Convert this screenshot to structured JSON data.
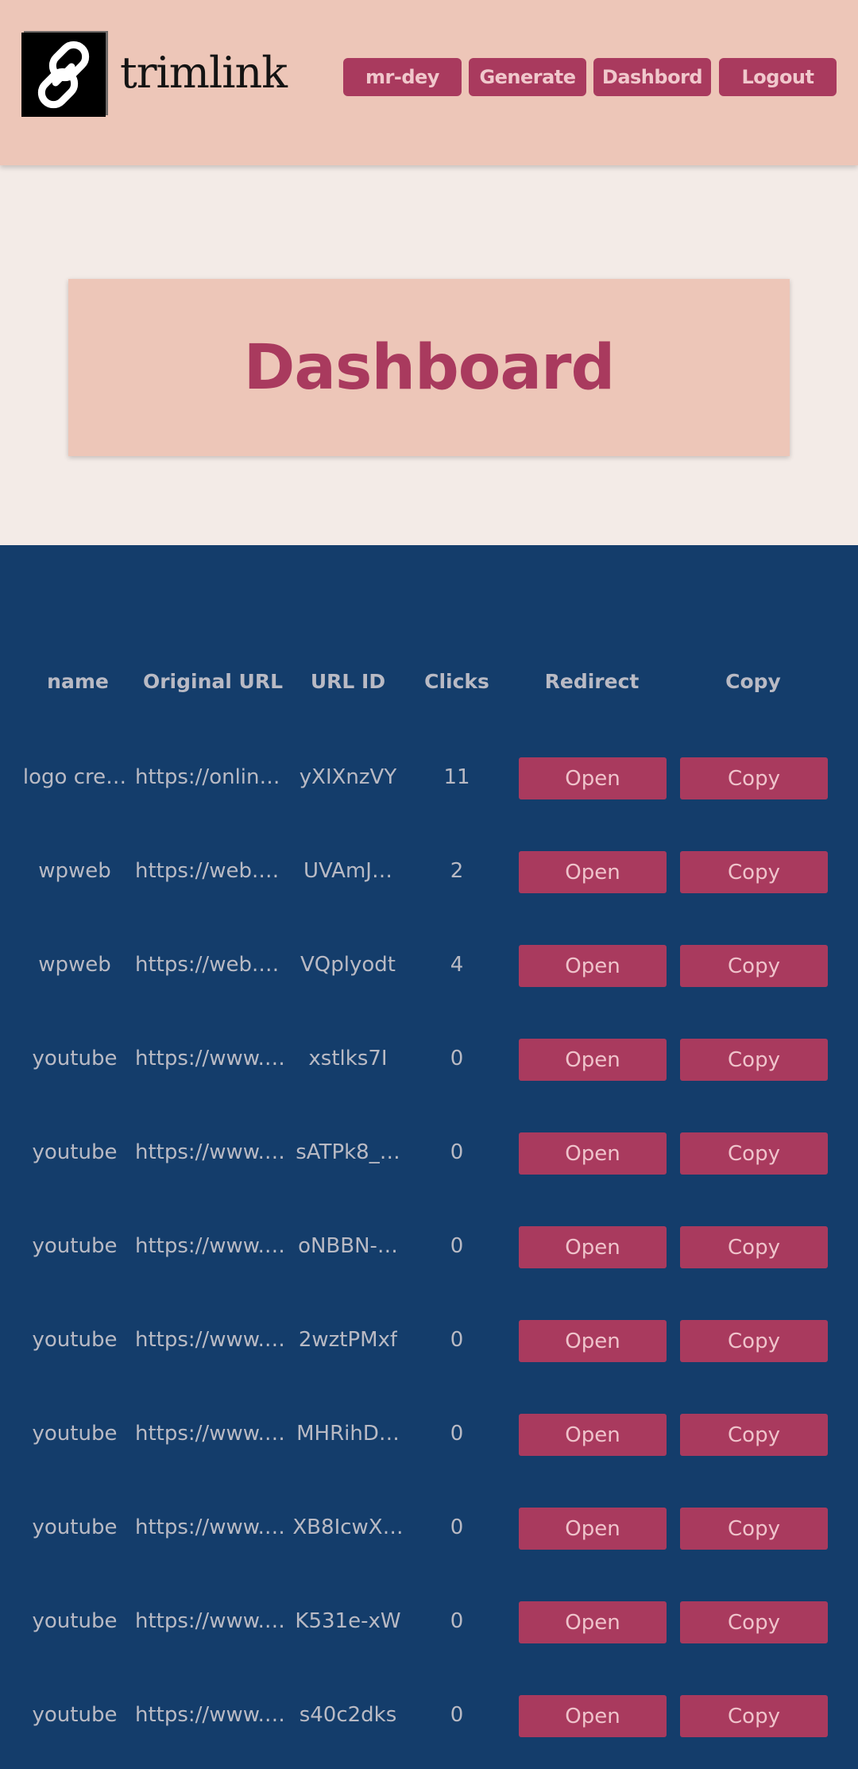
{
  "brand": {
    "name": "trimlink",
    "logo_icon": "chain-link-icon"
  },
  "nav": [
    {
      "label": "mr-dey"
    },
    {
      "label": "Generate"
    },
    {
      "label": "Dashbord"
    },
    {
      "label": "Logout"
    }
  ],
  "page_title": "Dashboard",
  "table": {
    "headers": {
      "name": "name",
      "original_url": "Original URL",
      "url_id": "URL ID",
      "clicks": "Clicks",
      "redirect": "Redirect",
      "copy": "Copy"
    },
    "rows": [
      {
        "name": "logo cre…",
        "url": "https://onlin…",
        "id": "yXIXnzVY",
        "clicks": "11",
        "open": "Open",
        "copy": "Copy"
      },
      {
        "name": "wpweb",
        "url": "https://web.…",
        "id": "UVAmJ…",
        "clicks": "2",
        "open": "Open",
        "copy": "Copy"
      },
      {
        "name": "wpweb",
        "url": "https://web.…",
        "id": "VQplyodt",
        "clicks": "4",
        "open": "Open",
        "copy": "Copy"
      },
      {
        "name": "youtube",
        "url": "https://www.…",
        "id": "xstlks7I",
        "clicks": "0",
        "open": "Open",
        "copy": "Copy"
      },
      {
        "name": "youtube",
        "url": "https://www.…",
        "id": "sATPk8_…",
        "clicks": "0",
        "open": "Open",
        "copy": "Copy"
      },
      {
        "name": "youtube",
        "url": "https://www.…",
        "id": "oNBBN-…",
        "clicks": "0",
        "open": "Open",
        "copy": "Copy"
      },
      {
        "name": "youtube",
        "url": "https://www.…",
        "id": "2wztPMxf",
        "clicks": "0",
        "open": "Open",
        "copy": "Copy"
      },
      {
        "name": "youtube",
        "url": "https://www.…",
        "id": "MHRihD…",
        "clicks": "0",
        "open": "Open",
        "copy": "Copy"
      },
      {
        "name": "youtube",
        "url": "https://www.…",
        "id": "XB8IcwX…",
        "clicks": "0",
        "open": "Open",
        "copy": "Copy"
      },
      {
        "name": "youtube",
        "url": "https://www.…",
        "id": "K531e-xW",
        "clicks": "0",
        "open": "Open",
        "copy": "Copy"
      },
      {
        "name": "youtube",
        "url": "https://www.…",
        "id": "s40c2dks",
        "clicks": "0",
        "open": "Open",
        "copy": "Copy"
      }
    ]
  },
  "colors": {
    "header_bg": "#edc6b8",
    "accent": "#a93a5e",
    "page_bg": "#f3ebe7",
    "table_bg": "#143d6b",
    "text_muted": "#b9bac4"
  }
}
